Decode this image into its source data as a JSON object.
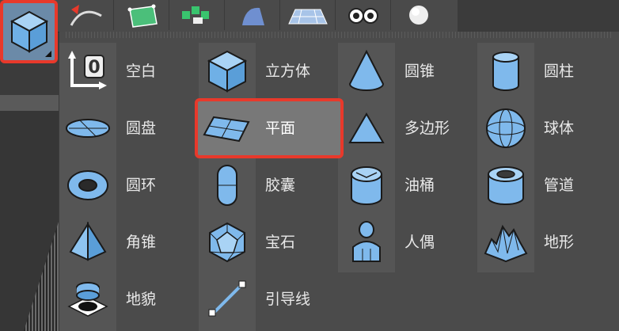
{
  "toolbar": {
    "buttons": [
      {
        "icon": "cube-icon"
      },
      {
        "icon": "pen-spline-icon"
      },
      {
        "icon": "subdivision-icon"
      },
      {
        "icon": "array-cubes-icon"
      },
      {
        "icon": "deformer-icon"
      },
      {
        "icon": "floor-grid-icon"
      },
      {
        "icon": "camera-eyes-icon"
      },
      {
        "icon": "light-sphere-icon"
      }
    ]
  },
  "menu": {
    "items": {
      "col1": [
        "空白",
        "圆盘",
        "圆环",
        "角锥",
        "地貌"
      ],
      "col2": [
        "立方体",
        "平面",
        "胶囊",
        "宝石",
        "引导线"
      ],
      "col3": [
        "圆锥",
        "多边形",
        "油桶",
        "人偶"
      ],
      "col4": [
        "圆柱",
        "球体",
        "管道",
        "地形"
      ]
    },
    "selected": "平面"
  },
  "colors": {
    "highlight": "#e8392b",
    "icon_fill": "#7fb9ec",
    "panel": "#4b4b4b"
  }
}
